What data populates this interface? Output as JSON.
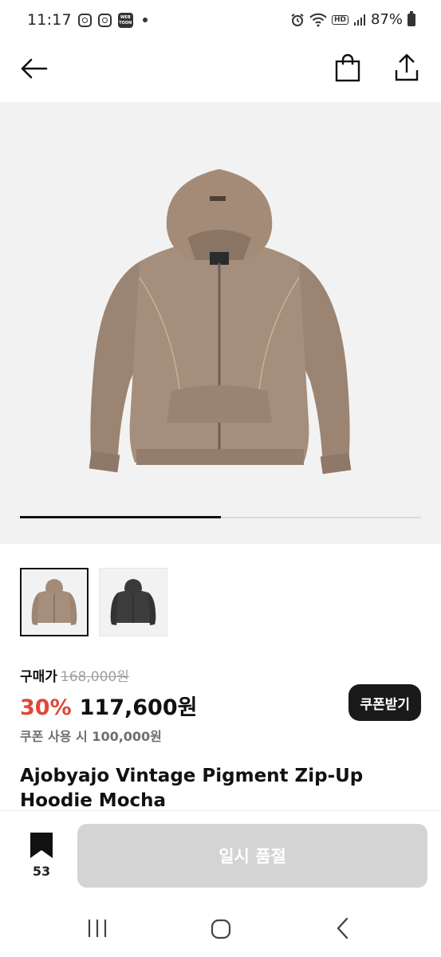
{
  "status_bar": {
    "time": "11:17",
    "battery": "87%",
    "network_badge": "HD",
    "left_icons": [
      "instagram-icon",
      "instagram-icon",
      "webtoon-icon",
      "dot-icon"
    ],
    "right_icons": [
      "alarm-icon",
      "wifi-icon",
      "hd-icon",
      "signal-icon",
      "battery-icon"
    ]
  },
  "app_bar": {
    "icons": [
      "arrow-left-icon",
      "shopping-bag-icon",
      "share-icon"
    ]
  },
  "gallery": {
    "progress": 0.5,
    "thumbnails": [
      {
        "name": "mocha",
        "color": "#9c8573",
        "selected": true
      },
      {
        "name": "black",
        "color": "#3b3b3b",
        "selected": false
      }
    ]
  },
  "price": {
    "label": "구매가",
    "original": "168,000원",
    "discount": "30%",
    "sale": "117,600원",
    "coupon_note": "쿠폰 사용 시 100,000원",
    "coupon_button": "쿠폰받기"
  },
  "product": {
    "title": "Ajobyajo Vintage Pigment Zip-Up Hoodie Mocha"
  },
  "bottom_bar": {
    "wish_count": "53",
    "soldout_label": "일시 품절"
  },
  "colors": {
    "discount": "#e0463a",
    "button_dark": "#1a1a1a",
    "soldout_bg": "#d4d4d4",
    "hero_bg": "#f2f2f2"
  }
}
